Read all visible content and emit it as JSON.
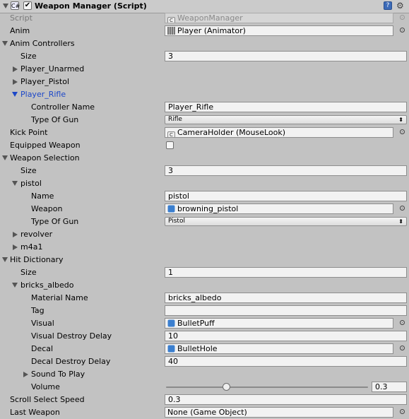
{
  "component": {
    "title": "Weapon Manager (Script)",
    "script_label": "Script",
    "script_value": "WeaponManager"
  },
  "anim": {
    "label": "Anim",
    "value": "Player (Animator)"
  },
  "anim_controllers": {
    "label": "Anim Controllers",
    "size_label": "Size",
    "size_value": "3",
    "items": [
      "Player_Unarmed",
      "Player_Pistol",
      "Player_Rifle"
    ],
    "rifle": {
      "controller_name_label": "Controller Name",
      "controller_name_value": "Player_Rifle",
      "type_label": "Type Of Gun",
      "type_value": "Rifle"
    }
  },
  "kick_point": {
    "label": "Kick Point",
    "value": "CameraHolder (MouseLook)"
  },
  "equipped_weapon": {
    "label": "Equipped Weapon",
    "checked": false
  },
  "weapon_selection": {
    "label": "Weapon Selection",
    "size_label": "Size",
    "size_value": "3",
    "pistol": {
      "label": "pistol",
      "name_label": "Name",
      "name_value": "pistol",
      "weapon_label": "Weapon",
      "weapon_value": "browning_pistol",
      "type_label": "Type Of Gun",
      "type_value": "Pistol"
    },
    "others": [
      "revolver",
      "m4a1"
    ]
  },
  "hit_dictionary": {
    "label": "Hit Dictionary",
    "size_label": "Size",
    "size_value": "1",
    "entry": {
      "label": "bricks_albedo",
      "material_name_label": "Material Name",
      "material_name_value": "bricks_albedo",
      "tag_label": "Tag",
      "tag_value": "",
      "visual_label": "Visual",
      "visual_value": "BulletPuff",
      "visual_delay_label": "Visual Destroy Delay",
      "visual_delay_value": "10",
      "decal_label": "Decal",
      "decal_value": "BulletHole",
      "decal_delay_label": "Decal Destroy Delay",
      "decal_delay_value": "40",
      "sound_label": "Sound To Play",
      "volume_label": "Volume",
      "volume_value": "0.3",
      "volume_fraction": 0.3
    }
  },
  "scroll_select_speed": {
    "label": "Scroll Select Speed",
    "value": "0.3"
  },
  "last_weapon": {
    "label": "Last Weapon",
    "value": "None (Game Object)"
  }
}
